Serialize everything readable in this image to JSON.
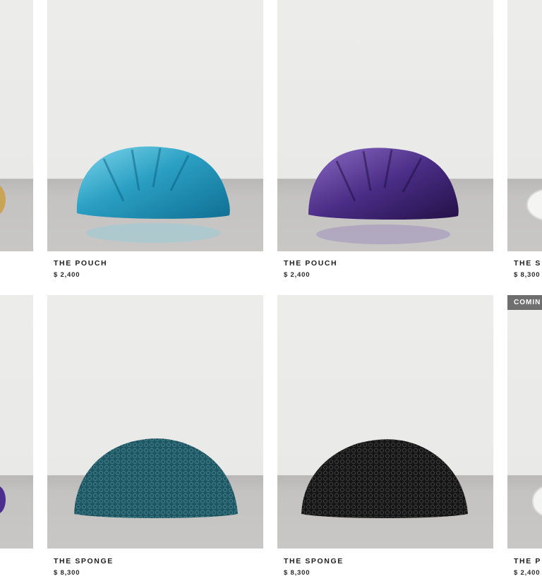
{
  "products": [
    {
      "name": "THE POUCH",
      "price": "$ 2,400",
      "color": "#35a9c8",
      "texture": "metallic"
    },
    {
      "name": "THE POUCH",
      "price": "$ 2,400",
      "color": "#4a2d86",
      "texture": "metallic"
    },
    {
      "name": "THE S",
      "price": "$ 8,300",
      "color": "#f4f4f2",
      "texture": "sponge"
    },
    {
      "name": "THE SPONGE",
      "price": "$ 8,300",
      "color": "#1f5560",
      "texture": "sponge"
    },
    {
      "name": "THE SPONGE",
      "price": "$ 8,300",
      "color": "#1b1b1b",
      "texture": "sponge"
    },
    {
      "name": "THE P",
      "price": "$ 2,400",
      "badge": "COMIN",
      "color": "#f4f4f2"
    }
  ],
  "partial_left": [
    {
      "color": "#c9a457"
    },
    {
      "color": "#4b2e90"
    }
  ]
}
